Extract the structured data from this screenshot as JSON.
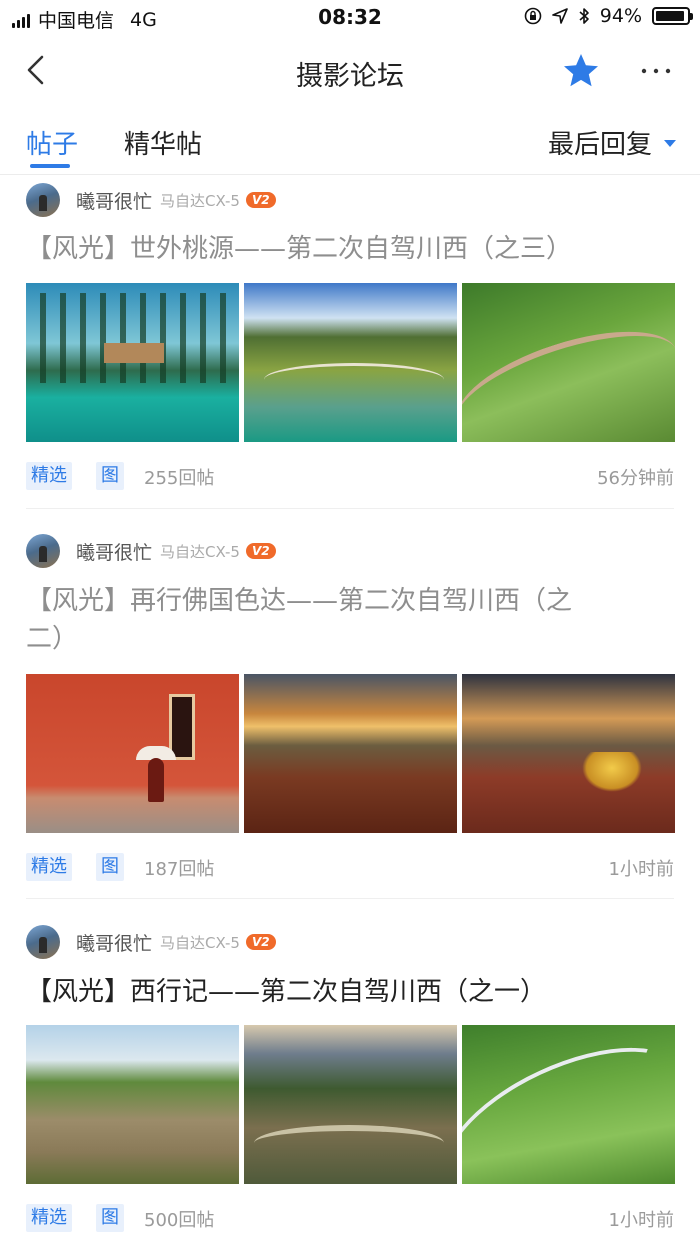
{
  "status_bar": {
    "carrier": "中国电信",
    "network": "4G",
    "time": "08:32",
    "battery": "94%",
    "battery_level": 0.94
  },
  "nav": {
    "title": "摄影论坛",
    "star_color": "#2e7be6"
  },
  "tabs": {
    "posts": "帖子",
    "featured": "精华帖",
    "sort": "最后回复"
  },
  "accent_color": "#2e7be6",
  "posts": [
    {
      "author": "曦哥很忙",
      "car": "马自达CX-5",
      "level": "V2",
      "title": "【风光】世外桃源——第二次自驾川西（之三）",
      "tags": [
        "精选",
        "图"
      ],
      "replies": "255回帖",
      "time": "56分钟前"
    },
    {
      "author": "曦哥很忙",
      "car": "马自达CX-5",
      "level": "V2",
      "title": "【风光】再行佛国色达——第二次自驾川西（之二）",
      "tags": [
        "精选",
        "图"
      ],
      "replies": "187回帖",
      "time": "1小时前"
    },
    {
      "author": "曦哥很忙",
      "car": "马自达CX-5",
      "level": "V2",
      "title": "【风光】西行记——第二次自驾川西（之一）",
      "tags": [
        "精选",
        "图"
      ],
      "replies": "500回帖",
      "time": "1小时前"
    }
  ]
}
